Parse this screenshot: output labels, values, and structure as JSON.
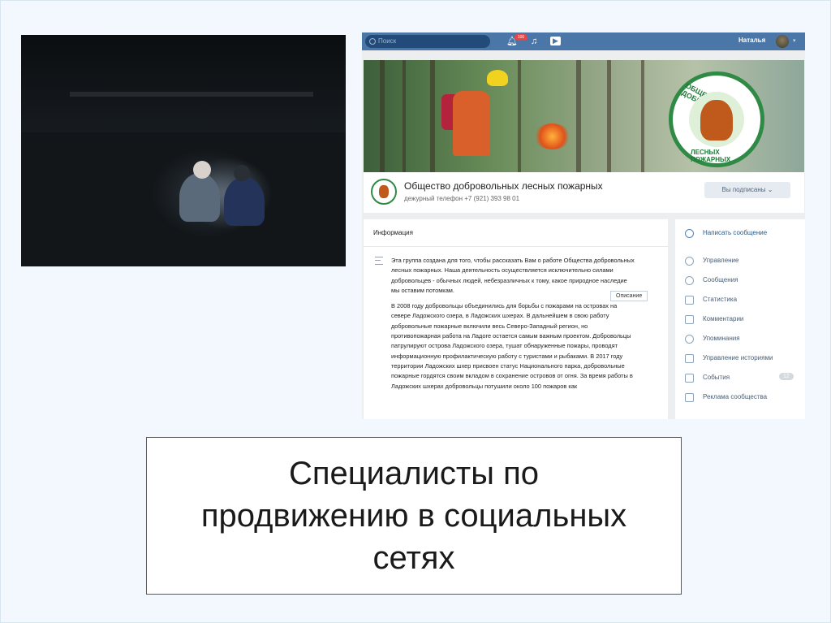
{
  "vk": {
    "search_placeholder": "Поиск",
    "notification_count": "100",
    "user_name": "Наталья",
    "group": {
      "name": "Общество добровольных лесных пожарных",
      "phone": "дежурный телефон +7 (921) 393 98 01",
      "subscribe_label": "Вы подписаны",
      "logo_text": [
        "ОБЩЕСТВО ДОБРОВОЛЬНЫХ",
        "ЛЕСНЫХ ПОЖАРНЫХ"
      ]
    },
    "info": {
      "heading": "Информация",
      "tooltip": "Описание",
      "paragraphs": [
        "Эта группа создана для того, чтобы рассказать Вам о работе Общества добровольных лесных пожарных. Наша деятельность осуществляется исключительно силами добровольцев - обычных людей, небезразличных к тому, какое природное наследие мы оставим потомкам.",
        "В 2008 году добровольцы объединились для борьбы с пожарами на островах на севере Ладожского озера, в Ладожских шхерах. В дальнейшем в свою работу добровольные пожарные включили весь Северо-Западный регион, но противопожарная работа на Ладоге остается самым важным проектом. Добровольцы патрулируют острова Ладожского озера, тушат обнаруженные пожары, проводят информационную профилактическую работу с туристами и рыбаками. В 2017 году территории Ладожских шхер присвоен статус Национального парка, добровольные пожарные гордятся своим вкладом в сохранение островов от огня. За время работы в Ладожских шхерах добровольцы потушили около 100 пожаров как"
      ]
    },
    "menu": {
      "primary": "Написать сообщение",
      "items": [
        "Управление",
        "Сообщения",
        "Статистика",
        "Комментарии",
        "Упоминания",
        "Управление историями",
        "События",
        "Реклама сообщества"
      ],
      "events_badge": "12"
    }
  },
  "caption": {
    "text": "Специалисты по\nпродвижению в социальных\nсетях"
  }
}
